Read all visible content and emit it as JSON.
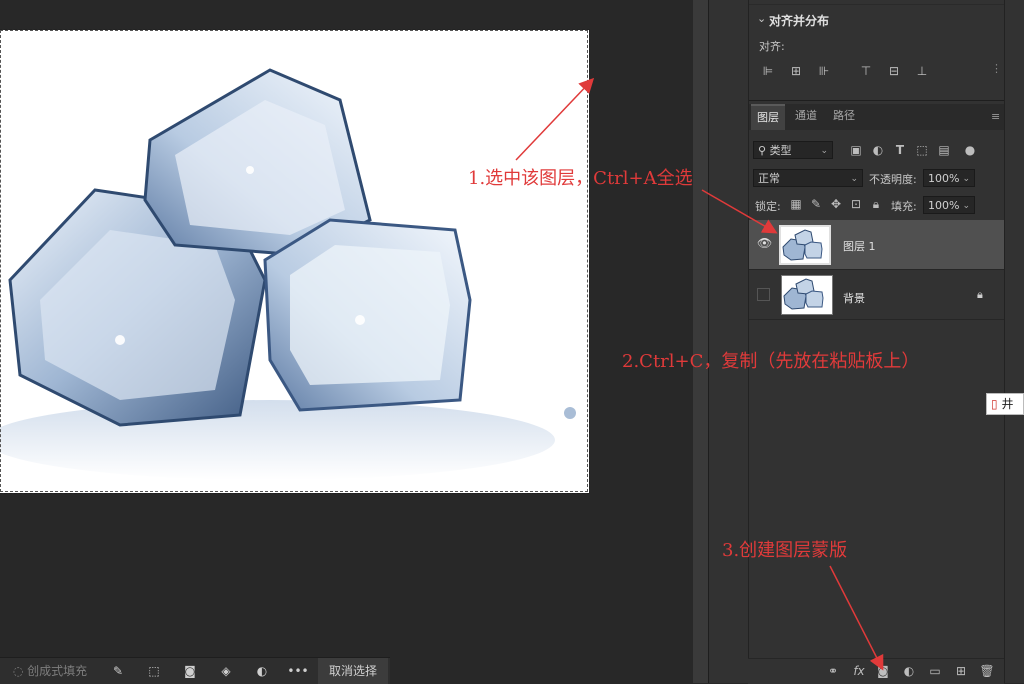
{
  "canvas": {
    "image_alt": ""
  },
  "align_panel": {
    "title": "对齐并分布",
    "align_label": "对齐:"
  },
  "layers_panel": {
    "tabs": [
      {
        "label": "图层"
      },
      {
        "label": "通道"
      },
      {
        "label": "路径"
      }
    ],
    "filter_kind": "类型",
    "blend_mode": "正常",
    "opacity_label": "不透明度:",
    "opacity_value": "100%",
    "lock_label": "锁定:",
    "fill_label": "填充:",
    "fill_value": "100%",
    "layers": [
      {
        "name": "图层 1"
      },
      {
        "name": "背景"
      }
    ]
  },
  "bottom_toolbar": {
    "generative_fill": "创成式填充",
    "deselect": "取消选择"
  },
  "annotations": {
    "step1": "1.选中该图层，Ctrl+A全选",
    "step2": "2.Ctrl+C，复制（先放在粘贴板上）",
    "step3": "3.创建图层蒙版"
  },
  "edge_popup": {
    "text": "井"
  },
  "colors": {
    "annotation": "#e03a3a",
    "panel_bg": "#323232",
    "canvas_bg": "#282828"
  }
}
